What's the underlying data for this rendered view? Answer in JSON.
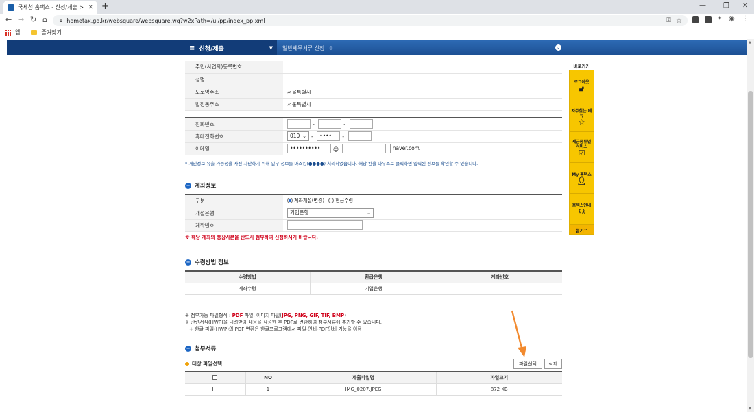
{
  "browser": {
    "tab_title": "국세청 홈택스 - 신청/제출 > 일",
    "tab_close": "✕",
    "new_tab": "+",
    "url": "hometax.go.kr/websquare/websquare.wq?w2xPath=/ui/pp/index_pp.xml",
    "bookmarks": {
      "apps": "앱",
      "favorites": "즐겨찾기"
    }
  },
  "topnav": {
    "menu_label": "신청/제출",
    "breadcrumb": "일반세무서류 신청"
  },
  "personal": {
    "rows": [
      {
        "label": "주민(사업자)등록번호",
        "value": ""
      },
      {
        "label": "성명",
        "value": ""
      },
      {
        "label": "도로명주소",
        "value": "서울특별시"
      },
      {
        "label": "법정동주소",
        "value": "서울특별시"
      }
    ]
  },
  "contact": {
    "phone_label": "전화번호",
    "mobile_label": "휴대전화번호",
    "mobile_prefix": "010",
    "mobile_mid": "••••",
    "email_label": "이메일",
    "email_id": "••••••••••",
    "email_at": "@",
    "email_domain": "naver.com",
    "notice": "* 개인정보 유출 가능성을 사전 차단하기 위해 일부 정보를 마스킹(●●●●) 처리하였습니다. 해당 칸을 마우스로 클릭하면 입력된 정보를 확인할 수 있습니다."
  },
  "account": {
    "title": "계좌정보",
    "type_label": "구분",
    "opt_account": "계좌개설(변경)",
    "opt_cash": "현금수령",
    "bank_label": "개설은행",
    "bank_value": "기업은행",
    "number_label": "계좌번호",
    "warning": "※ 해당 계좌의 통장사본을 반드시 첨부하여 신청하시기 바랍니다."
  },
  "receipt": {
    "title": "수령방법 정보",
    "headers": [
      "수령방법",
      "환급은행",
      "계좌번호"
    ],
    "row": [
      "계좌수령",
      "기업은행",
      ""
    ]
  },
  "info": {
    "line1_a": "※ 첨부가능 파일형식 : ",
    "line1_b": "PDF",
    "line1_c": " 파일, 이미지 파일(",
    "line1_d": "JPG, PNG, GIF, TIF, BMP",
    "line1_e": ")",
    "line2": "※ 관련서식(HWP)을 내려받아 내용을 작성한 후 PDF로 변환하여 첨부서류에 추가할 수 있습니다.",
    "line3": "+ 한글 파일(HWP)의 PDF 변환은 한글프로그램에서 파일-인쇄-PDF인쇄 기능을 이용"
  },
  "attach": {
    "title": "첨부서류",
    "sub_title": "대상 파일선택",
    "select_btn": "파일선택",
    "delete_btn": "삭제",
    "headers": [
      "NO",
      "제출파일명",
      "파일크기"
    ],
    "files": [
      {
        "no": "1",
        "name": "IMG_0207.JPEG",
        "size": "872 KB"
      }
    ]
  },
  "side": {
    "header": "바로가기",
    "items": [
      "로그아웃",
      "자주찾는 메뉴",
      "세금종류별 서비스",
      "My 홈택스",
      "홈택스안내"
    ],
    "close": "접기^"
  },
  "colors": {
    "nav_blue": "#1c4f92",
    "side_yellow": "#f7c600",
    "arrow": "#f28a2e",
    "warn_red": "#d0021b"
  }
}
